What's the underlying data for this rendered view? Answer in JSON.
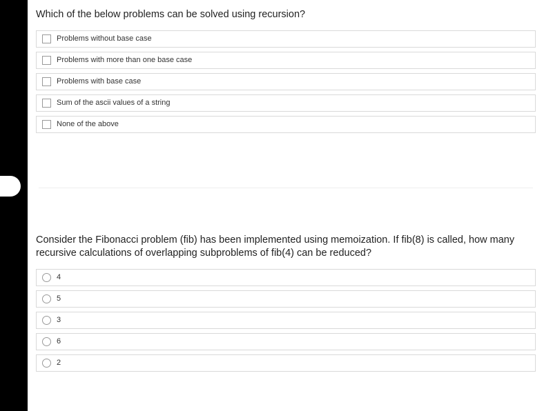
{
  "q1": {
    "prompt": "Which of the below problems can be solved using recursion?",
    "options": [
      "Problems without base case",
      "Problems with more than one base case",
      "Problems with base case",
      "Sum of the ascii values of a string",
      "None of the above"
    ]
  },
  "q2": {
    "prompt": "Consider the Fibonacci problem (fib) has been implemented using memoization. If fib(8) is called, how many recursive calculations of overlapping subproblems of fib(4) can be reduced?",
    "options": [
      "4",
      "5",
      "3",
      "6",
      "2"
    ]
  }
}
